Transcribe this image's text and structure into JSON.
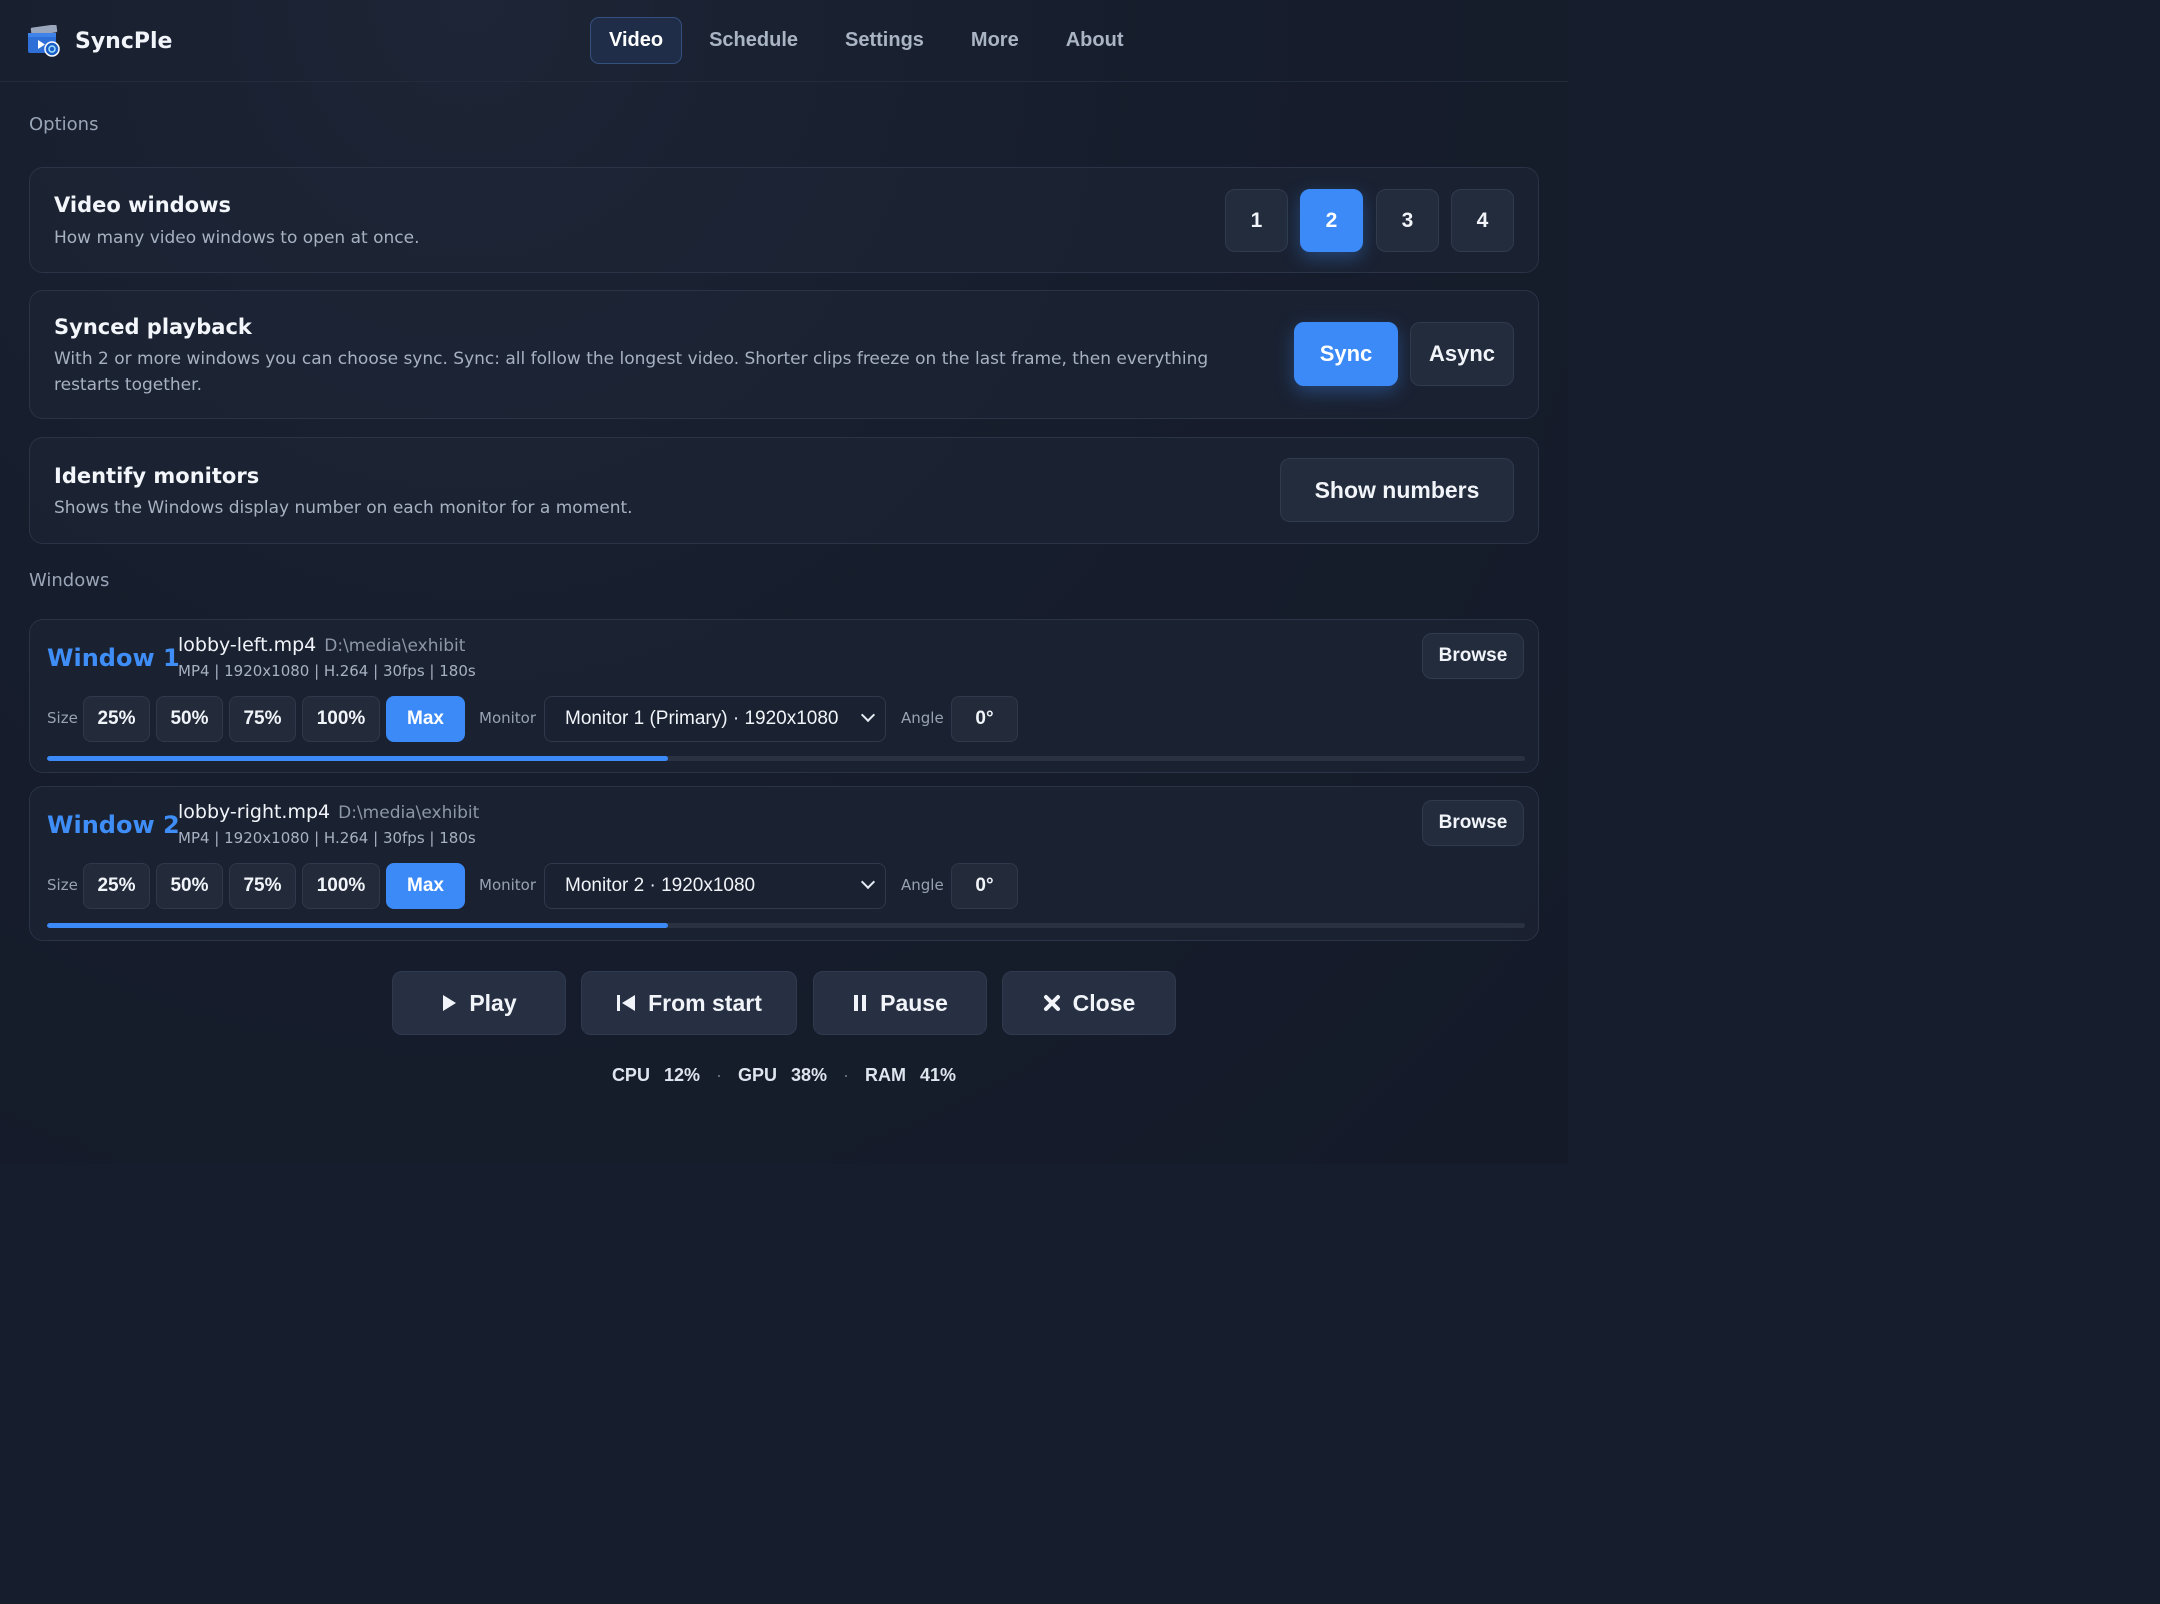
{
  "app": {
    "name": "SyncPle",
    "accent": "#3c8af7"
  },
  "nav": {
    "tabs": [
      "Video",
      "Schedule",
      "Settings",
      "More",
      "About"
    ],
    "active": "Video"
  },
  "options": {
    "section_title": "Options",
    "video_windows": {
      "title": "Video windows",
      "desc": "How many video windows to open at once.",
      "choices": [
        "1",
        "2",
        "3",
        "4"
      ],
      "selected": "2"
    },
    "synced_playback": {
      "title": "Synced playback",
      "desc": "With 2 or more windows you can choose sync. Sync: all follow the longest video. Shorter clips freeze on the last frame, then everything restarts together.",
      "sync_label": "Sync",
      "async_label": "Async",
      "selected": "Sync"
    },
    "identify_monitors": {
      "title": "Identify monitors",
      "desc": "Shows the Windows display number on each monitor for a moment.",
      "button_label": "Show numbers"
    }
  },
  "windows": {
    "section_title": "Windows",
    "size_label": "Size",
    "monitor_label": "Monitor",
    "angle_label": "Angle",
    "browse_label": "Browse",
    "size_options": [
      "25%",
      "50%",
      "75%",
      "100%",
      "Max"
    ],
    "items": [
      {
        "title": "Window 1",
        "filename": "lobby-left.mp4",
        "path": "D:\\media\\exhibit",
        "meta": "MP4 | 1920x1080 | H.264 | 30fps | 180s",
        "size_selected": "Max",
        "monitor": "Monitor 1 (Primary) · 1920x1080",
        "angle": "0°",
        "progress": 0.42
      },
      {
        "title": "Window 2",
        "filename": "lobby-right.mp4",
        "path": "D:\\media\\exhibit",
        "meta": "MP4 | 1920x1080 | H.264 | 30fps | 180s",
        "size_selected": "Max",
        "monitor": "Monitor 2 · 1920x1080",
        "angle": "0°",
        "progress": 0.42
      }
    ]
  },
  "controls": {
    "play": "Play",
    "from_start": "From start",
    "pause": "Pause",
    "close": "Close"
  },
  "stats": {
    "cpu_label": "CPU",
    "cpu": "12%",
    "gpu_label": "GPU",
    "gpu": "38%",
    "ram_label": "RAM",
    "ram": "41%",
    "separator": "·"
  }
}
